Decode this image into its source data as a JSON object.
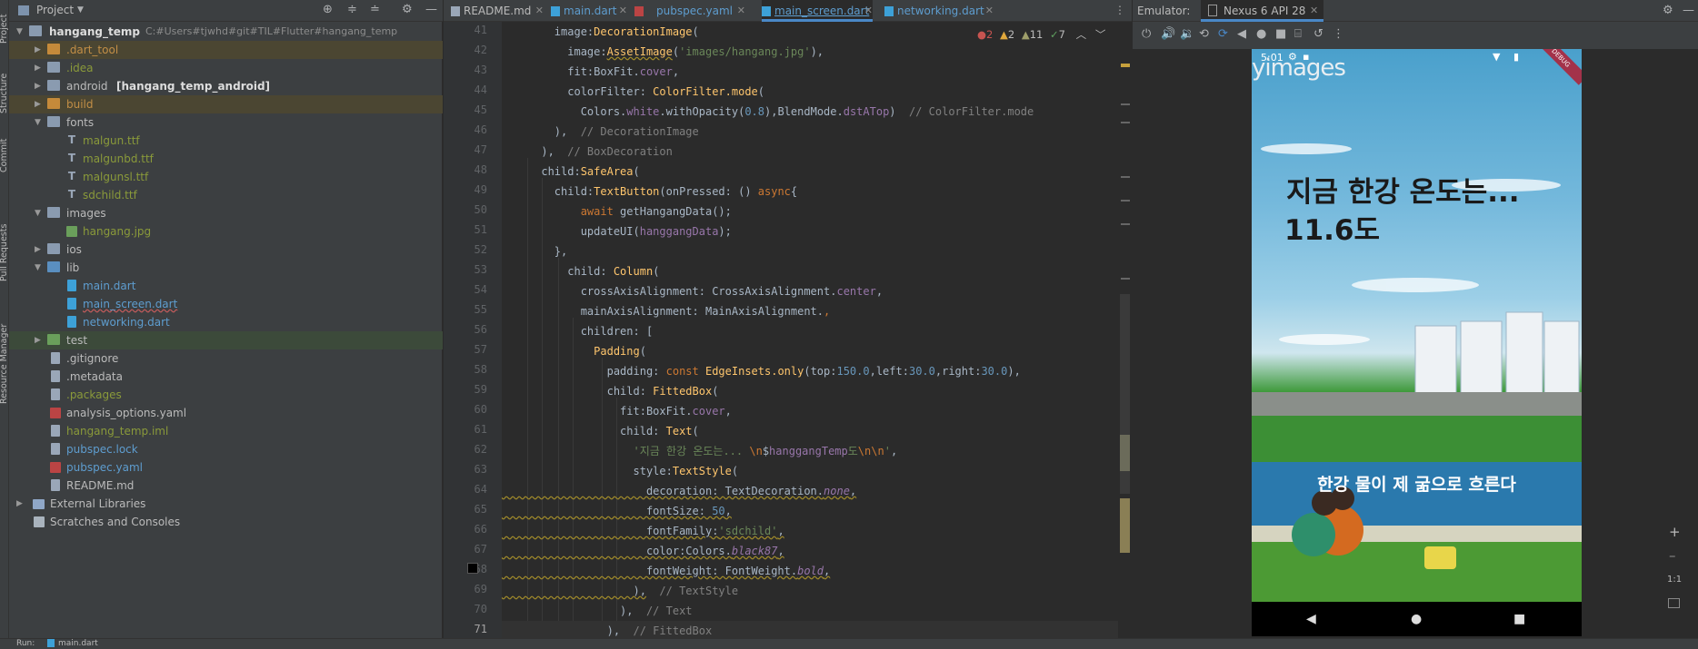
{
  "sidebar_strip": {
    "labels": [
      "Project",
      "Structure",
      "Commit",
      "Pull Requests",
      "Resource Manager"
    ]
  },
  "project_panel": {
    "title": "Project",
    "dropdown_icon": "chevron-down-icon",
    "header_icons": [
      "crosshair-icon",
      "collapse-icon",
      "expand-icon",
      "gear-icon",
      "minimize-icon"
    ],
    "root": {
      "name": "hangang_temp",
      "path": "C:#Users#tjwhd#git#TIL#Flutter#hangang_temp"
    },
    "items": [
      {
        "label": ".dart_tool",
        "extra": ""
      },
      {
        "label": ".idea",
        "extra": ""
      },
      {
        "label": "android",
        "extra": "[hangang_temp_android]"
      },
      {
        "label": "build",
        "extra": ""
      },
      {
        "label": "fonts",
        "extra": ""
      },
      {
        "label": "malgun.ttf",
        "extra": ""
      },
      {
        "label": "malgunbd.ttf",
        "extra": ""
      },
      {
        "label": "malgunsl.ttf",
        "extra": ""
      },
      {
        "label": "sdchild.ttf",
        "extra": ""
      },
      {
        "label": "images",
        "extra": ""
      },
      {
        "label": "hangang.jpg",
        "extra": ""
      },
      {
        "label": "ios",
        "extra": ""
      },
      {
        "label": "lib",
        "extra": ""
      },
      {
        "label": "main.dart",
        "extra": ""
      },
      {
        "label": "main_screen.dart",
        "extra": ""
      },
      {
        "label": "networking.dart",
        "extra": ""
      },
      {
        "label": "test",
        "extra": ""
      },
      {
        "label": ".gitignore",
        "extra": ""
      },
      {
        "label": ".metadata",
        "extra": ""
      },
      {
        "label": ".packages",
        "extra": ""
      },
      {
        "label": "analysis_options.yaml",
        "extra": ""
      },
      {
        "label": "hangang_temp.iml",
        "extra": ""
      },
      {
        "label": "pubspec.lock",
        "extra": ""
      },
      {
        "label": "pubspec.yaml",
        "extra": ""
      },
      {
        "label": "README.md",
        "extra": ""
      },
      {
        "label": "External Libraries",
        "extra": ""
      },
      {
        "label": "Scratches and Consoles",
        "extra": ""
      }
    ]
  },
  "editor": {
    "tabs": [
      {
        "label": "README.md"
      },
      {
        "label": "main.dart"
      },
      {
        "label": "pubspec.yaml"
      },
      {
        "label": "main_screen.dart"
      },
      {
        "label": "networking.dart"
      }
    ],
    "inspections": {
      "errors": "2",
      "warnings": "2",
      "weak": "11",
      "ok": "7"
    },
    "line_numbers": [
      "41",
      "42",
      "43",
      "44",
      "45",
      "46",
      "47",
      "48",
      "49",
      "50",
      "51",
      "52",
      "53",
      "54",
      "55",
      "56",
      "57",
      "58",
      "59",
      "60",
      "61",
      "62",
      "63",
      "64",
      "65",
      "66",
      "67",
      "68",
      "69",
      "70",
      "71"
    ]
  },
  "emulator": {
    "label": "Emulator:",
    "device_tab": "Nexus 6 API 28",
    "time": "5:01",
    "banner": "DEBUG",
    "watermark": "yimages",
    "title_line1": "지금 한강 온도는...",
    "title_line2": "11.6도",
    "caption": "한강 물이 제 굶으로 흐른다",
    "zoom_controls": [
      "+",
      "–",
      "1:1"
    ],
    "toolbar_icons": [
      "power-icon",
      "volume-up-icon",
      "volume-down-icon",
      "rotate-left-icon",
      "rotate-right-icon",
      "back-icon",
      "home-icon",
      "overview-icon",
      "camera-icon",
      "replay-icon",
      "more-icon"
    ]
  },
  "bottom_bar": {
    "run_label": "Run:",
    "config": "main.dart"
  }
}
